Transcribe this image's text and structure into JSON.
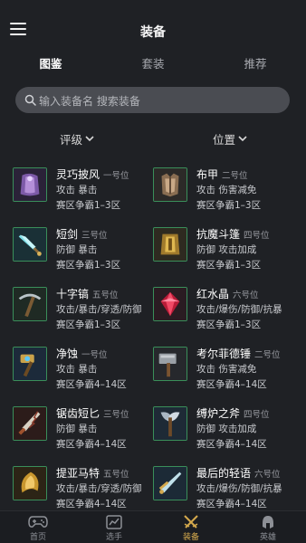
{
  "header": {
    "title": "装备"
  },
  "tabs": [
    {
      "label": "图鉴",
      "active": true
    },
    {
      "label": "套装",
      "active": false
    },
    {
      "label": "推荐",
      "active": false
    }
  ],
  "search": {
    "placeholder": "输入装备名 搜索装备"
  },
  "filters": [
    {
      "label": "评级"
    },
    {
      "label": "位置"
    }
  ],
  "items": [
    {
      "name": "灵巧披风",
      "rank": "一号位",
      "tags": "攻击 暴击",
      "tier": "赛区争霸1–3区",
      "icon": "cloak-icon"
    },
    {
      "name": "布甲",
      "rank": "二号位",
      "tags": "攻击 伤害减免",
      "tier": "赛区争霸1–3区",
      "icon": "armor-icon"
    },
    {
      "name": "短剑",
      "rank": "三号位",
      "tags": "防御 暴击",
      "tier": "赛区争霸1–3区",
      "icon": "short-sword-icon"
    },
    {
      "name": "抗魔斗篷",
      "rank": "四号位",
      "tags": "防御 攻击加成",
      "tier": "赛区争霸1–3区",
      "icon": "magic-cloak-icon"
    },
    {
      "name": "十字镐",
      "rank": "五号位",
      "tags": "攻击/暴击/穿透/防御",
      "tier": "赛区争霸1–3区",
      "icon": "pickaxe-icon"
    },
    {
      "name": "红水晶",
      "rank": "六号位",
      "tags": "攻击/爆伤/防御/抗暴",
      "tier": "赛区争霸1–3区",
      "icon": "red-crystal-icon"
    },
    {
      "name": "净蚀",
      "rank": "一号位",
      "tags": "攻击 暴击",
      "tier": "赛区争霸4–14区",
      "icon": "purify-hammer-icon"
    },
    {
      "name": "考尔菲德锤",
      "rank": "二号位",
      "tags": "攻击 伤害减免",
      "tier": "赛区争霸4–14区",
      "icon": "warhammer-icon"
    },
    {
      "name": "锯齿短匕",
      "rank": "三号位",
      "tags": "防御 暴击",
      "tier": "赛区争霸4–14区",
      "icon": "serrated-dagger-icon"
    },
    {
      "name": "缚炉之斧",
      "rank": "四号位",
      "tags": "防御 攻击加成",
      "tier": "赛区争霸4–14区",
      "icon": "axe-icon"
    },
    {
      "name": "提亚马特",
      "rank": "五号位",
      "tags": "攻击/暴击/穿透/防御",
      "tier": "赛区争霸4–14区",
      "icon": "tiamat-icon"
    },
    {
      "name": "最后的轻语",
      "rank": "六号位",
      "tags": "攻击/爆伤/防御/抗暴",
      "tier": "赛区争霸4–14区",
      "icon": "last-whisper-icon"
    }
  ],
  "nav": [
    {
      "label": "首页",
      "icon": "gamepad-icon",
      "active": false
    },
    {
      "label": "选手",
      "icon": "chart-icon",
      "active": false
    },
    {
      "label": "装备",
      "icon": "crossed-swords-icon",
      "active": true
    },
    {
      "label": "英雄",
      "icon": "helmet-icon",
      "active": false
    }
  ],
  "colors": {
    "accent": "#d4a94d",
    "background": "#1f2125",
    "search_bg": "#4a4c52",
    "icon_border": "#3a8f5a"
  }
}
